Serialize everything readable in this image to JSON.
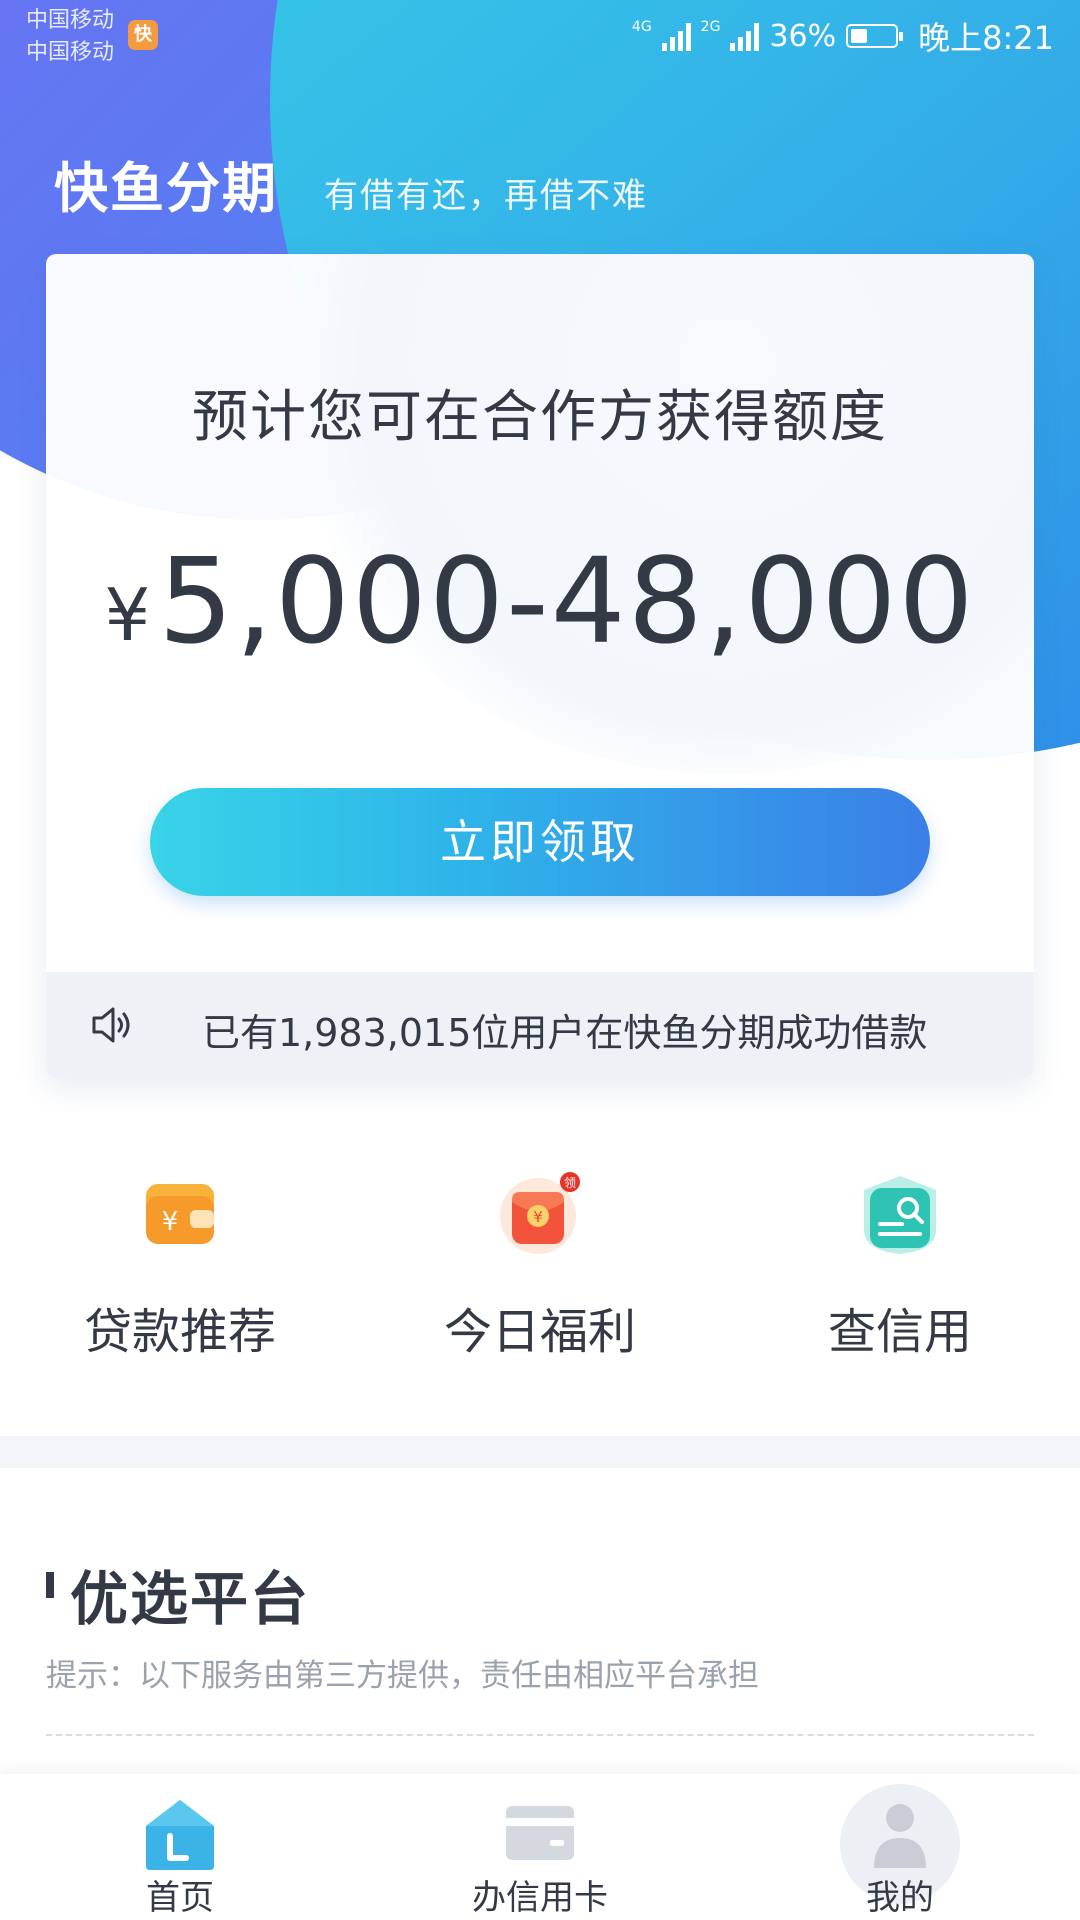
{
  "status_bar": {
    "carrier_1": "中国移动",
    "carrier_2": "中国移动",
    "app_badge": "快",
    "network_1": "4G",
    "network_2": "2G",
    "battery_percent": "36%",
    "time": "晚上8:21"
  },
  "header": {
    "title": "快鱼分期",
    "slogan": "有借有还，再借不难"
  },
  "quota_card": {
    "label": "预计您可在合作方获得额度",
    "currency": "¥",
    "amount": "5,000-48,000",
    "claim_button": "立即领取",
    "notice": "已有1,983,015位用户在快鱼分期成功借款"
  },
  "features": [
    {
      "label": "贷款推荐",
      "icon": "wallet-icon"
    },
    {
      "label": "今日福利",
      "icon": "red-envelope-icon",
      "badge": "领"
    },
    {
      "label": "查信用",
      "icon": "credit-search-icon"
    }
  ],
  "section": {
    "title": "优选平台",
    "hint": "提示：以下服务由第三方提供，责任由相应平台承担"
  },
  "tab_bar": {
    "items": [
      {
        "label": "首页",
        "icon": "home-icon",
        "active": true
      },
      {
        "label": "办信用卡",
        "icon": "credit-card-icon",
        "active": false
      },
      {
        "label": "我的",
        "icon": "profile-icon",
        "active": false
      }
    ]
  },
  "colors": {
    "brand_cyan": "#37d2e6",
    "brand_blue": "#3b7fe7",
    "brand_purple": "#7a6cf5",
    "text_primary": "#333a45",
    "text_hint": "#9aa2ad"
  }
}
